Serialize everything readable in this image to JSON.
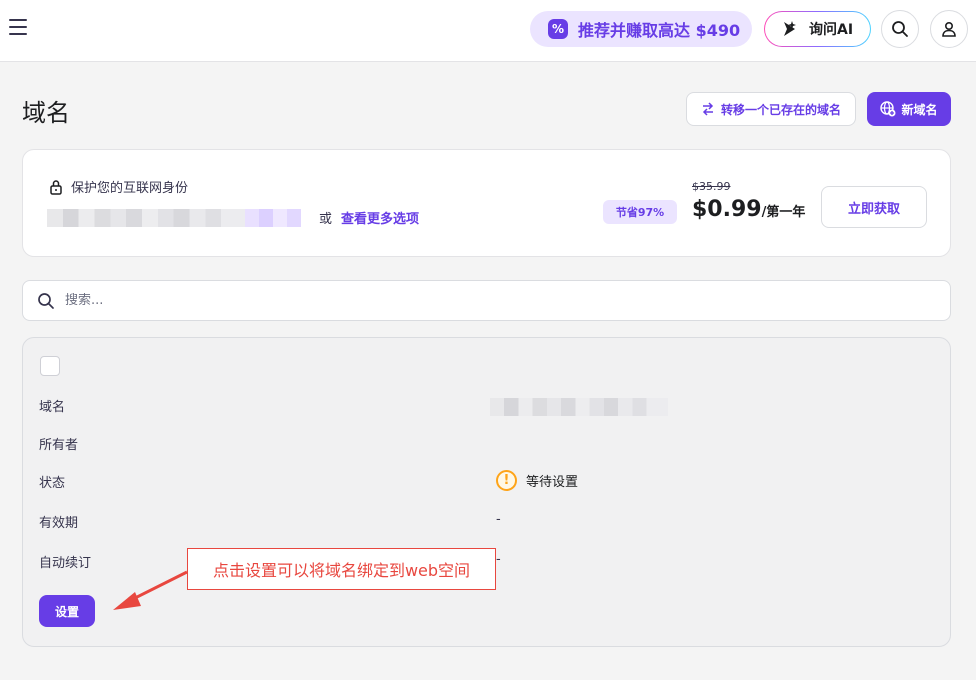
{
  "topbar": {
    "promo_label": "推荐并赚取高达 $490",
    "ask_ai_label": "询问AI"
  },
  "header": {
    "title": "域名",
    "transfer_label": "转移一个已存在的域名",
    "new_domain_label": "新域名"
  },
  "promo_card": {
    "title": "保护您的互联网身份",
    "or_text": "或",
    "more_options_label": "查看更多选项",
    "save_badge": "节省97%",
    "old_price": "$35.99",
    "new_price": "$0.99",
    "price_period": "/第一年",
    "get_button_label": "立即获取"
  },
  "search": {
    "placeholder": "搜索..."
  },
  "domain_list": {
    "rows": [
      {
        "label": "域名",
        "value": ""
      },
      {
        "label": "所有者",
        "value": ""
      },
      {
        "label": "状态",
        "value": "等待设置"
      },
      {
        "label": "有效期",
        "value": "-"
      },
      {
        "label": "自动续订",
        "value": "-"
      }
    ],
    "setup_button_label": "设置"
  },
  "annotation": {
    "text": "点击设置可以将域名绑定到web空间"
  },
  "colors": {
    "accent": "#673de6",
    "accent_light": "#ebe4ff",
    "warning": "#fea419",
    "annotation_red": "#e8473f"
  },
  "icons": [
    "menu-icon",
    "badge-percent-icon",
    "ai-spark-icon",
    "search-icon",
    "user-icon",
    "lock-icon",
    "transfer-icon",
    "globe-plus-icon",
    "warning-icon"
  ]
}
